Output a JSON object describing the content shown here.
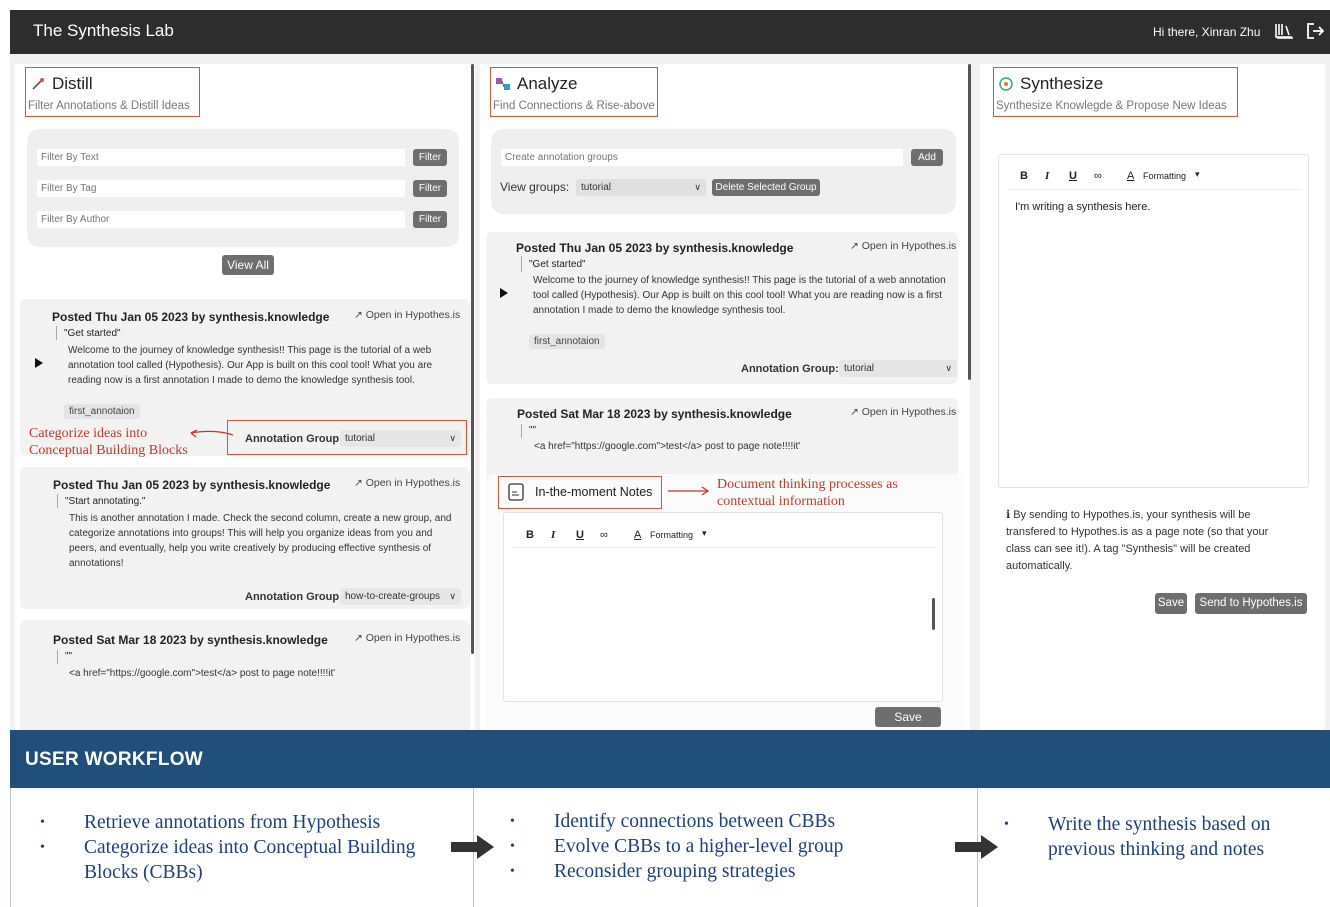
{
  "header": {
    "app_title": "The Synthesis Lab",
    "greeting": "Hi there, Xinran Zhu",
    "icons": [
      "library-icon",
      "logout-icon"
    ]
  },
  "distill": {
    "title": "Distill",
    "subtitle": "Filter Annotations & Distill Ideas",
    "icon": "magic-wand-icon",
    "filters": [
      {
        "placeholder": "Filter By Text",
        "button": "Filter"
      },
      {
        "placeholder": "Filter By Tag",
        "button": "Filter"
      },
      {
        "placeholder": "Filter By Author",
        "button": "Filter"
      }
    ],
    "view_all": "View All",
    "cards": [
      {
        "posted": "Posted Thu Jan 05 2023 by synthesis.knowledge",
        "open": "Open in Hypothes.is",
        "quote": "\"Get started\"",
        "body": [
          "Welcome to the journey of knowledge synthesis!! This page is the tutorial of a web",
          "annotation tool called (Hypothesis). Our App is built on this cool tool! What you are",
          "reading now is a first annotation I made to demo the knowledge synthesis tool."
        ],
        "tag": "first_annotaion",
        "group_label": "Annotation Group:",
        "group_value": "tutorial"
      },
      {
        "posted": "Posted Thu Jan 05 2023 by synthesis.knowledge",
        "open": "Open in Hypothes.is",
        "quote": "\"Start annotating.\"",
        "body": [
          "This is another annotation I made. Check the second column, create a new group, and",
          "categorize annotations into groups! This will help you organize ideas from you and",
          "peers, and eventually, help you write creatively by producing effective synthesis of",
          "annotations!"
        ],
        "group_label": "Annotation Group:",
        "group_value": "how-to-create-groups"
      },
      {
        "posted": "Posted Sat Mar 18 2023 by synthesis.knowledge",
        "open": "Open in Hypothes.is",
        "quote": "\"\"",
        "body": [
          "<a href=\"https://google.com\">test</a> post to page note!!!!it'"
        ]
      }
    ],
    "callout": [
      "Categorize ideas into",
      "Conceptual Building Blocks"
    ]
  },
  "analyze": {
    "title": "Analyze",
    "subtitle": "Find Connections & Rise-above",
    "icon": "connections-icon",
    "group_placeholder": "Create annotation groups",
    "add_button": "Add",
    "view_groups_label": "View groups:",
    "view_groups_value": "tutorial",
    "delete_button": "Delete Selected Group",
    "cards": [
      {
        "posted": "Posted Thu Jan 05 2023 by synthesis.knowledge",
        "open": "Open in Hypothes.is",
        "quote": "\"Get started\"",
        "body": [
          "Welcome to the journey of knowledge synthesis!! This page is the tutorial of a web annotation",
          "tool called (Hypothesis). Our App is built on this cool tool! What you are reading now is a first",
          "annotation I made to demo the knowledge synthesis tool."
        ],
        "tag": "first_annotaion",
        "group_label": "Annotation Group:",
        "group_value": "tutorial"
      },
      {
        "posted": "Posted Sat Mar 18 2023 by synthesis.knowledge",
        "open": "Open in Hypothes.is",
        "quote": "\"\"",
        "body": [
          "<a href=\"https://google.com\">test</a> post to page note!!!!it'"
        ]
      }
    ],
    "notes": {
      "title": "In-the-moment Notes",
      "icon": "notes-icon",
      "toolbar": {
        "bold": "B",
        "italic": "I",
        "underline": "U",
        "formatting": "Formatting"
      },
      "save": "Save"
    },
    "callout": [
      "Document thinking processes as",
      "contextual information"
    ]
  },
  "synthesize": {
    "title": "Synthesize",
    "subtitle": "Synthesize Knowlegde & Propose New Ideas",
    "icon": "brain-icon",
    "toolbar": {
      "bold": "B",
      "italic": "I",
      "underline": "U",
      "formatting": "Formatting"
    },
    "editor_text": "I'm writing a synthesis here.",
    "info": [
      "By sending to Hypothes.is, your synthesis will be",
      "transfered to Hypothes.is as a page note (so that your",
      "class can see it!). A tag \"Synthesis\" will be created",
      "automatically."
    ],
    "save": "Save",
    "send": "Send to Hypothes.is"
  },
  "workflow": {
    "title": "USER WORKFLOW",
    "col1": [
      "Retrieve annotations from Hypothesis",
      "Categorize ideas into Conceptual Building",
      "Blocks (CBBs)"
    ],
    "col2": [
      "Identify connections between CBBs",
      "Evolve CBBs to a higher-level group",
      "Reconsider grouping strategies"
    ],
    "col3": [
      "Write the synthesis based on",
      "previous thinking and notes"
    ]
  },
  "colors": {
    "topbar": "#2d2d2d",
    "workflow": "#1f4f7a",
    "accent_red": "#d9523b",
    "workflow_text": "#1d3f7c"
  }
}
